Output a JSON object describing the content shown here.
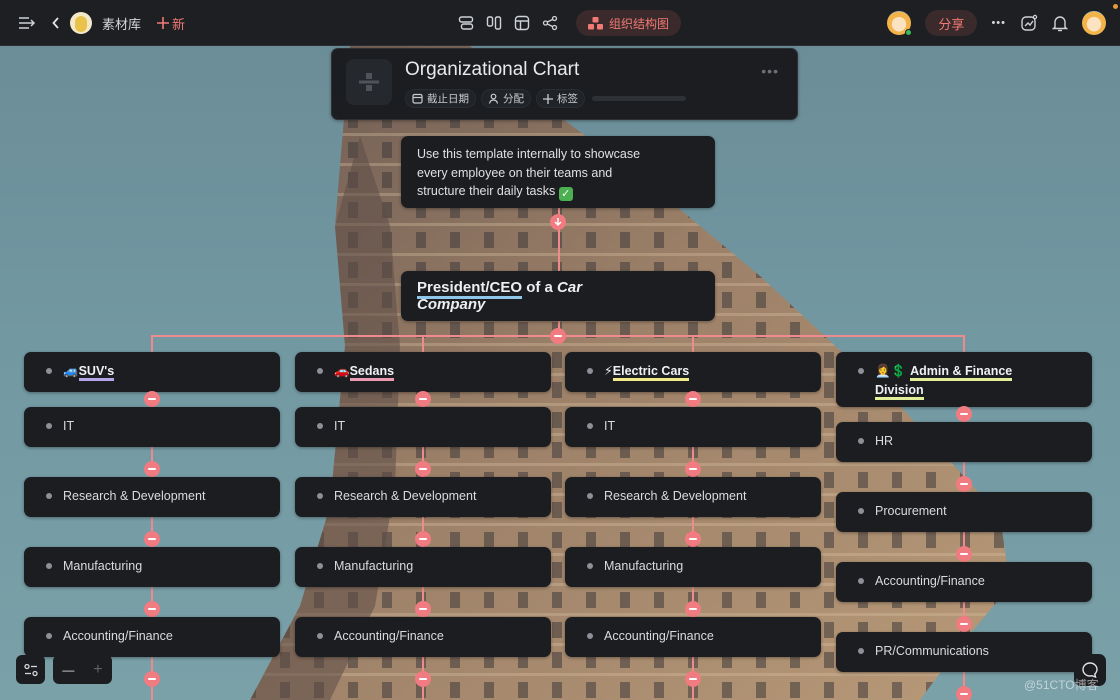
{
  "topbar": {
    "library_name": "素材库",
    "new_label": "新",
    "view_label": "组织结构图",
    "share_label": "分享",
    "more_label": "•••"
  },
  "header_card": {
    "title": "Organizational Chart",
    "chips": [
      {
        "icon": "calendar-icon",
        "label": "截止日期"
      },
      {
        "icon": "person-icon",
        "label": "分配"
      },
      {
        "icon": "plus-icon",
        "label": "标签"
      }
    ],
    "more_label": "•••"
  },
  "description": {
    "lines": [
      "Use this template internally to showcase",
      "every employee on their teams and",
      "structure their daily tasks"
    ],
    "emoji": "✓"
  },
  "ceo": {
    "title_part1": "President/CEO",
    "title_part2": " of a ",
    "title_part3": "Car",
    "title_part4": "Company"
  },
  "columns": [
    {
      "emoji": "🚙",
      "head": "SUV's",
      "underline": "#b3a6e8",
      "items": [
        "IT",
        "Research & Development",
        "Manufacturing",
        "Accounting/Finance"
      ]
    },
    {
      "emoji": "🚗",
      "head": "Sedans",
      "underline": "#ec9bb3",
      "items": [
        "IT",
        "Research & Development",
        "Manufacturing",
        "Accounting/Finance"
      ]
    },
    {
      "emoji": "⚡",
      "head": "Electric Cars",
      "underline": "#f1e98a",
      "items": [
        "IT",
        "Research & Development",
        "Manufacturing",
        "Accounting/Finance"
      ]
    },
    {
      "emoji": "👩‍💼💲",
      "head_line1": "Admin & Finance",
      "head_line2": "Division",
      "underline": "#e2ee98",
      "items": [
        "HR",
        "Procurement",
        "Accounting/Finance",
        "PR/Communications"
      ]
    }
  ],
  "zoom": {
    "minus": "—",
    "plus": "+"
  },
  "watermark": "@51CTO博客",
  "colors": {
    "accent": "#f07b80",
    "connector": "#ef8a8e",
    "card_bg": "#1b1d20",
    "topbar_bg": "#1d1f22",
    "ceo_underline": "#8fc7ea"
  }
}
